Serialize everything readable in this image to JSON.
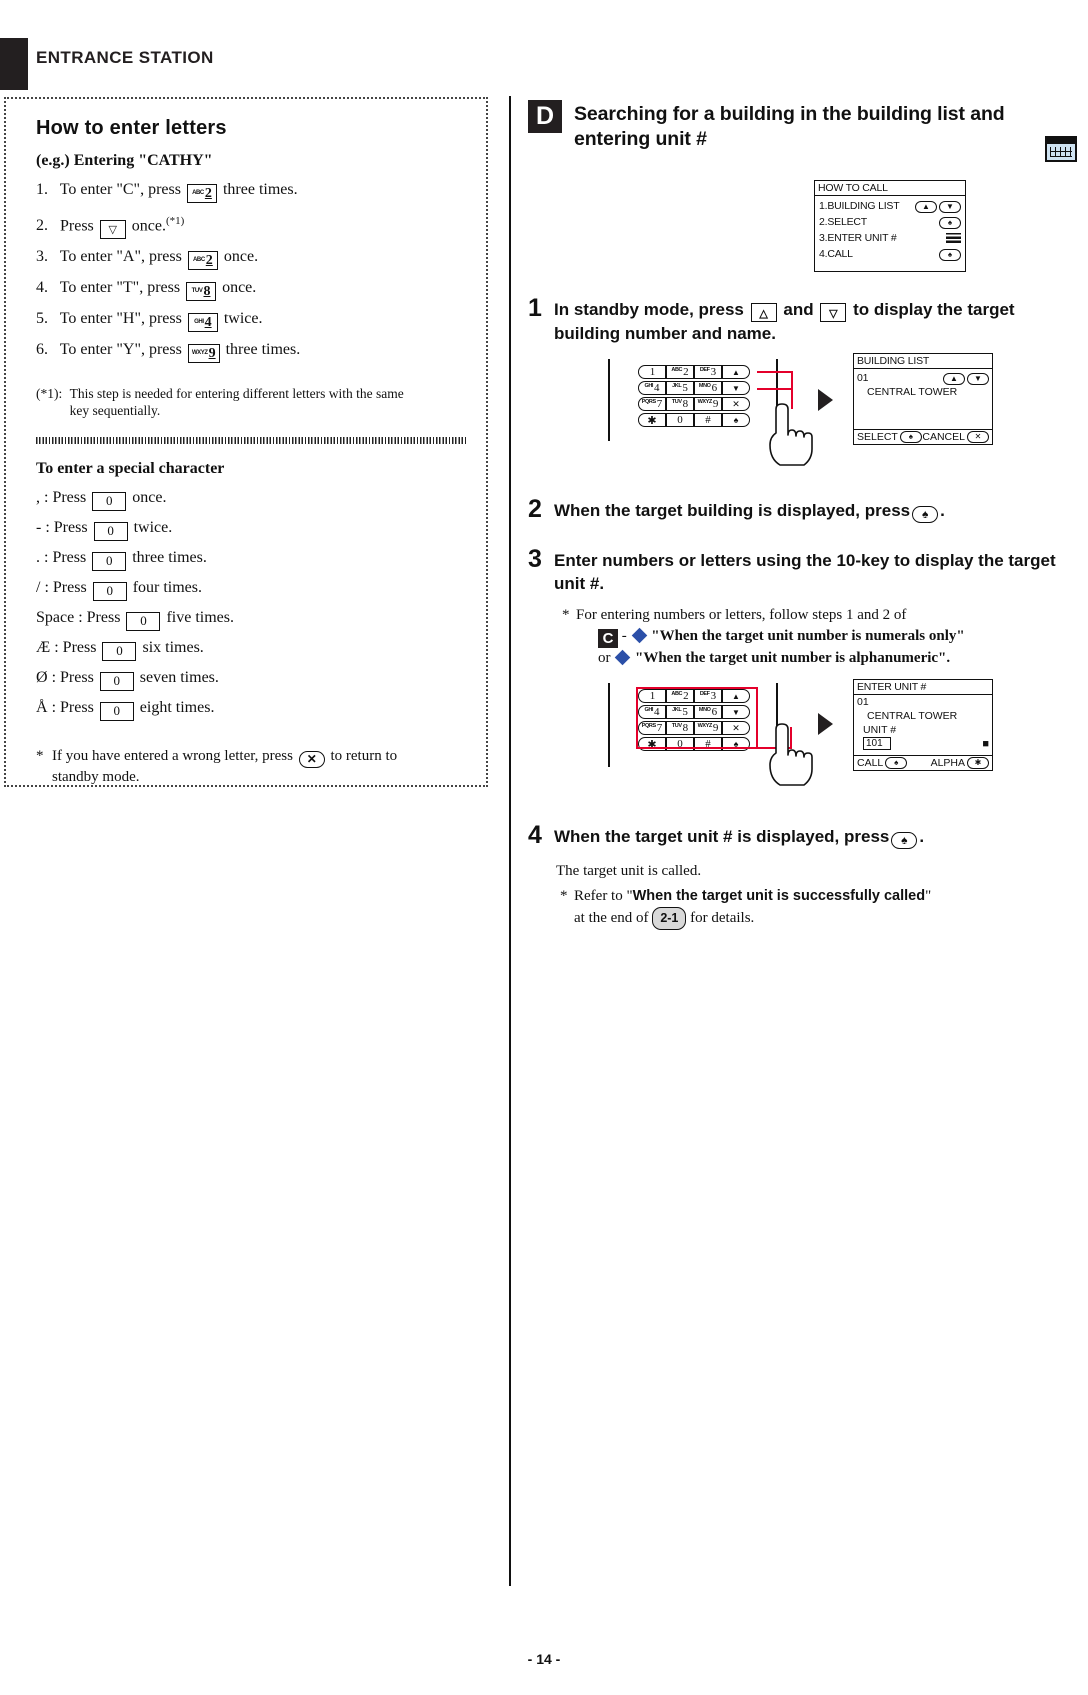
{
  "header": {
    "title": "ENTRANCE STATION"
  },
  "page_number": "- 14 -",
  "left_panel": {
    "title": "How to enter letters",
    "example_label": "(e.g.) Entering \"CATHY\"",
    "steps": [
      {
        "n": "1.",
        "pre": "To enter \"C\", press",
        "key_label": "ABC",
        "key_digit": "2",
        "post": "three times."
      },
      {
        "n": "2.",
        "pre": "Press",
        "key_label": "",
        "key_digit": "▽",
        "post": "once.",
        "sup": "(*1)"
      },
      {
        "n": "3.",
        "pre": "To enter \"A\", press",
        "key_label": "ABC",
        "key_digit": "2",
        "post": "once."
      },
      {
        "n": "4.",
        "pre": "To enter \"T\", press",
        "key_label": "TUV",
        "key_digit": "8",
        "post": "once."
      },
      {
        "n": "5.",
        "pre": "To enter \"H\", press",
        "key_label": "GHI",
        "key_digit": "4",
        "post": "twice."
      },
      {
        "n": "6.",
        "pre": "To enter \"Y\", press",
        "key_label": "WXYZ",
        "key_digit": "9",
        "post": "three times."
      }
    ],
    "footnote_tag": "(*1):",
    "footnote_text": "This step is needed for entering different letters with the same key sequentially.",
    "special_title": "To enter a special character",
    "special_items": [
      {
        "char": ",",
        "pre": ": Press",
        "key": "0",
        "post": "once."
      },
      {
        "char": "-",
        "pre": ": Press",
        "key": "0",
        "post": "twice."
      },
      {
        "char": ".",
        "pre": ": Press",
        "key": "0",
        "post": "three times."
      },
      {
        "char": "/",
        "pre": ": Press",
        "key": "0",
        "post": "four times."
      },
      {
        "char": "Space",
        "pre": ": Press",
        "key": "0",
        "post": "five times."
      },
      {
        "char": "Æ",
        "pre": ": Press",
        "key": "0",
        "post": "six times."
      },
      {
        "char": "Ø",
        "pre": ": Press",
        "key": "0",
        "post": "seven times."
      },
      {
        "char": "Å",
        "pre": ": Press",
        "key": "0",
        "post": "eight times."
      }
    ],
    "bottom_note_star": "*",
    "bottom_note_pre": "If you have entered a wrong letter, press",
    "bottom_note_key": "✕",
    "bottom_note_post": "to return to standby mode."
  },
  "right_panel": {
    "badge": "D",
    "heading": "Searching for a building in the building list and entering unit #",
    "how_to_call": {
      "title": "HOW TO CALL",
      "rows": [
        {
          "label": "1.BUILDING LIST",
          "icons": [
            "▲",
            "▼"
          ]
        },
        {
          "label": "2.SELECT",
          "icons": [
            "♠"
          ]
        },
        {
          "label": "3.ENTER UNIT #",
          "icons": [
            "hamburger"
          ]
        },
        {
          "label": "4.CALL",
          "icons": [
            "♠"
          ]
        }
      ]
    },
    "steps": [
      {
        "n": "1",
        "text_parts": [
          "In standby mode, press",
          "and",
          "to display the target building number and name."
        ],
        "keys": [
          "△",
          "▽"
        ]
      },
      {
        "n": "2",
        "text_parts": [
          "When the target building is displayed, press",
          "."
        ],
        "keys": [
          "♠"
        ]
      },
      {
        "n": "3",
        "text_parts": [
          "Enter numbers or letters using the 10-key to display the target unit #."
        ],
        "keys": []
      },
      {
        "n": "4",
        "text_parts": [
          "When the target unit # is displayed, press",
          "."
        ],
        "keys": [
          "♠"
        ]
      }
    ],
    "step3_note": {
      "star": "*",
      "line1": "For entering numbers or letters, follow steps 1 and 2 of",
      "badge": "C",
      "dash": "-",
      "quote1": "\"When the target unit number is numerals only\"",
      "or": "or",
      "quote2": "\"When the target unit number is alphanumeric\"."
    },
    "step4_tail": {
      "line1": "The target unit is called.",
      "star": "*",
      "refer_pre": "Refer to \"",
      "refer_bold": "When the target unit is successfully called",
      "refer_post": "\"",
      "at_end_of": "at the end of",
      "chip": "2-1",
      "for_details": "for details."
    },
    "keypad": {
      "rows": [
        [
          {
            "sm": "",
            "bg": "1"
          },
          {
            "sm": "ABC",
            "bg": "2"
          },
          {
            "sm": "DEF",
            "bg": "3"
          },
          {
            "sm": "",
            "bg": "▲"
          }
        ],
        [
          {
            "sm": "GHI",
            "bg": "4"
          },
          {
            "sm": "JKL",
            "bg": "5"
          },
          {
            "sm": "MNO",
            "bg": "6"
          },
          {
            "sm": "",
            "bg": "▼"
          }
        ],
        [
          {
            "sm": "PQRS",
            "bg": "7"
          },
          {
            "sm": "TUV",
            "bg": "8"
          },
          {
            "sm": "WXYZ",
            "bg": "9"
          },
          {
            "sm": "",
            "bg": "✕"
          }
        ],
        [
          {
            "sm": "",
            "bg": "✱"
          },
          {
            "sm": "",
            "bg": "0"
          },
          {
            "sm": "",
            "bg": "#"
          },
          {
            "sm": "",
            "bg": "♠"
          }
        ]
      ]
    },
    "building_list": {
      "title": "BUILDING LIST",
      "number": "01",
      "name": "CENTRAL TOWER",
      "icons_top": [
        "▲",
        "▼"
      ],
      "footer_left_label": "SELECT",
      "footer_left_icon": "♠",
      "footer_right_label": "CANCEL",
      "footer_right_icon": "✕"
    },
    "enter_unit": {
      "title": "ENTER UNIT #",
      "number": "01",
      "name": "CENTRAL TOWER",
      "unit_label": "UNIT #",
      "unit_value": "101",
      "cursor": "■",
      "footer_left_label": "CALL",
      "footer_left_icon": "♠",
      "footer_right_label": "ALPHA",
      "footer_right_icon": "✱"
    }
  },
  "colors": {
    "ink": "#231f20",
    "red": "#e4002b",
    "blue_diamond": "#2b4fa8",
    "lcd_icon": "#cfe3f2"
  }
}
